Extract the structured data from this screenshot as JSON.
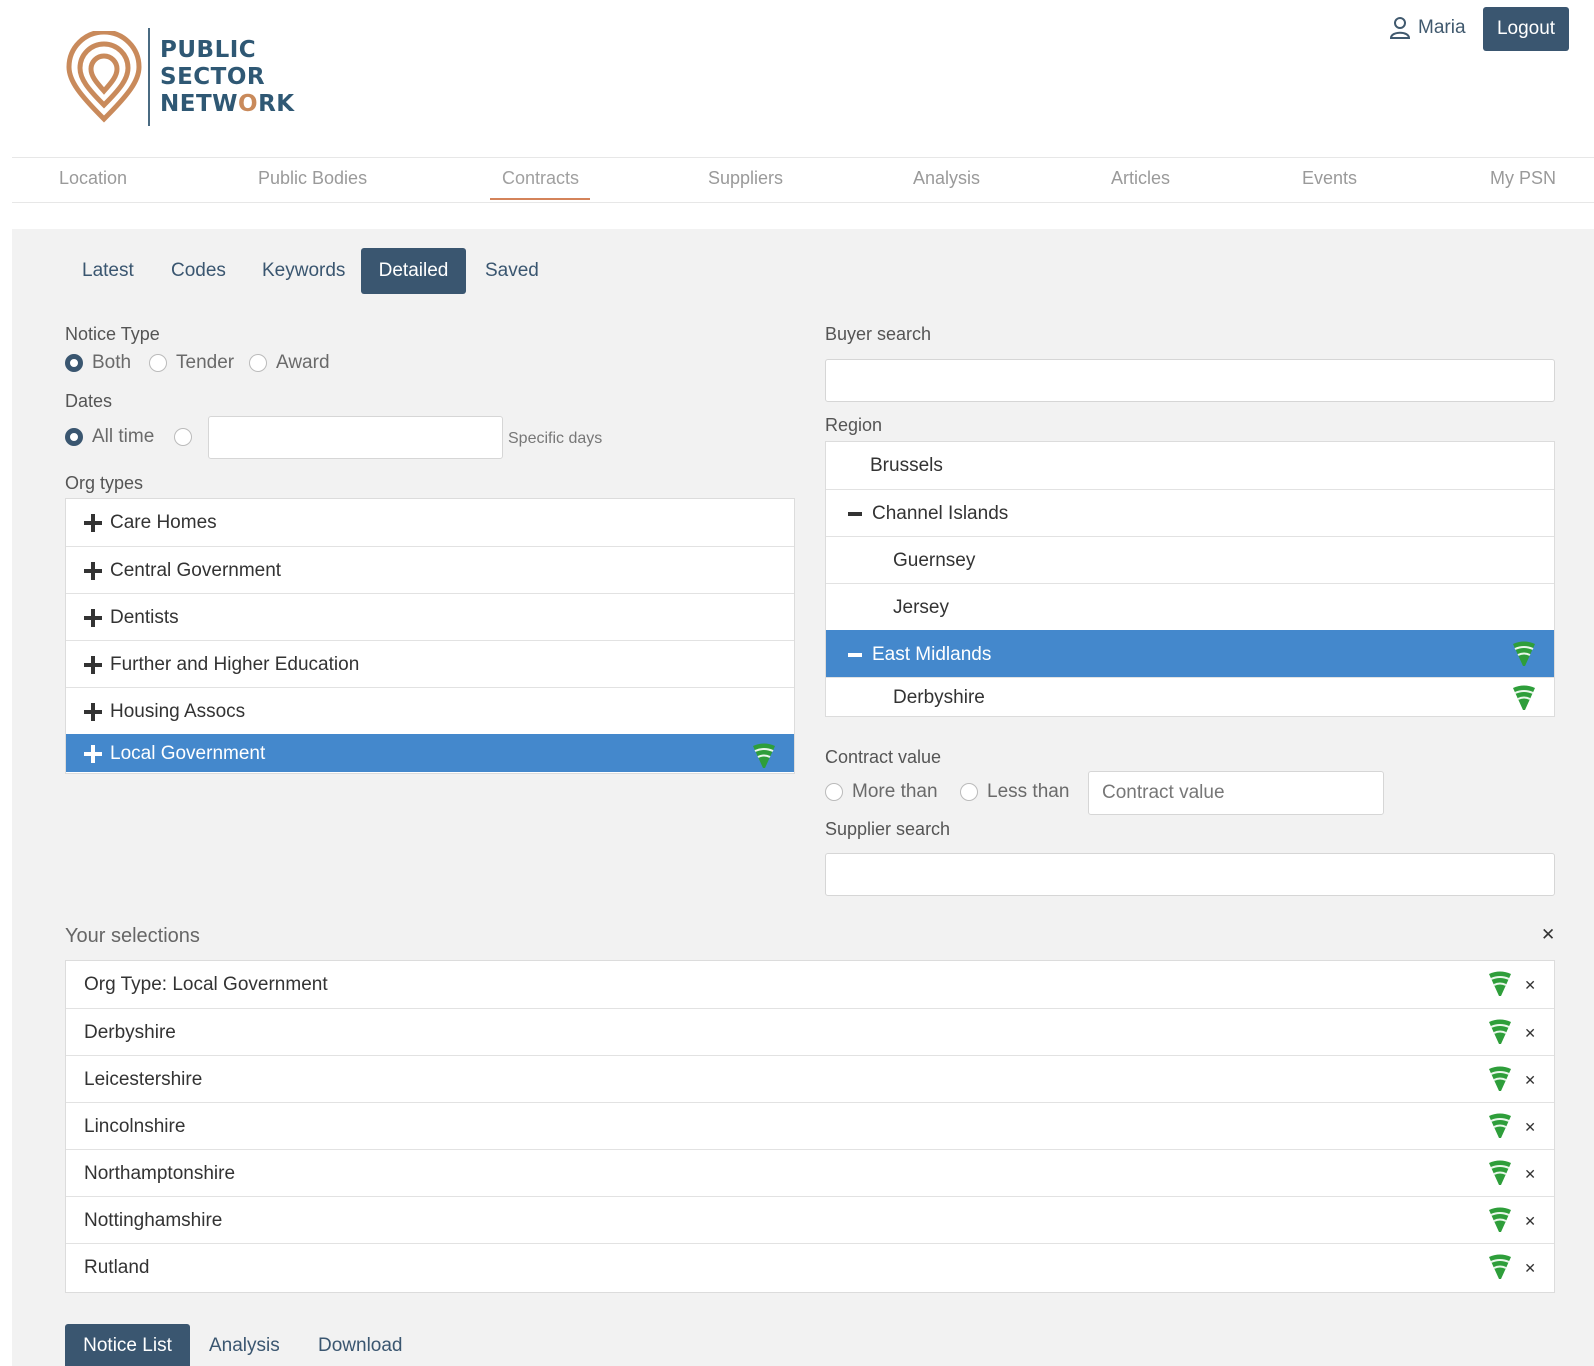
{
  "logo": {
    "line1": "PUBLIC",
    "line2": "SECTOR",
    "line3a": "NETW",
    "line3o": "O",
    "line3b": "RK"
  },
  "user": {
    "name": "Maria",
    "logout_label": "Logout"
  },
  "main_nav": [
    "Location",
    "Public Bodies",
    "Contracts",
    "Suppliers",
    "Analysis",
    "Articles",
    "Events",
    "My PSN"
  ],
  "main_nav_active": "Contracts",
  "sub_tabs": [
    "Latest",
    "Codes",
    "Keywords",
    "Detailed",
    "Saved"
  ],
  "sub_tab_active": "Detailed",
  "notice_type": {
    "label": "Notice Type",
    "options": [
      "Both",
      "Tender",
      "Award"
    ],
    "selected": "Both"
  },
  "dates": {
    "label": "Dates",
    "all_time": "All time",
    "specific_days": "Specific days",
    "value": ""
  },
  "org_types": {
    "label": "Org types",
    "items": [
      "Care Homes",
      "Central Government",
      "Dentists",
      "Further and Higher Education",
      "Housing Assocs",
      "Local Government"
    ],
    "selected": "Local Government"
  },
  "buyer_search": {
    "label": "Buyer search",
    "value": ""
  },
  "region": {
    "label": "Region",
    "items": [
      {
        "label": "Brussels",
        "indent": 0,
        "sign": ""
      },
      {
        "label": "Channel Islands",
        "indent": 0,
        "sign": "minus"
      },
      {
        "label": "Guernsey",
        "indent": 1,
        "sign": ""
      },
      {
        "label": "Jersey",
        "indent": 1,
        "sign": ""
      },
      {
        "label": "East Midlands",
        "indent": 0,
        "sign": "minus",
        "selected": true,
        "icon": "cone-icon"
      },
      {
        "label": "Derbyshire",
        "indent": 1,
        "sign": "",
        "icon": "cone-icon"
      }
    ]
  },
  "contract_value": {
    "label": "Contract value",
    "more_than": "More than",
    "less_than": "Less than",
    "placeholder": "Contract value"
  },
  "supplier_search": {
    "label": "Supplier search",
    "value": ""
  },
  "selections": {
    "label": "Your selections",
    "items": [
      "Org Type: Local Government",
      "Derbyshire",
      "Leicestershire",
      "Lincolnshire",
      "Northamptonshire",
      "Nottinghamshire",
      "Rutland"
    ]
  },
  "bottom_tabs": [
    "Notice List",
    "Analysis",
    "Download"
  ],
  "bottom_tab_active": "Notice List",
  "colors": {
    "navy": "#3a5670",
    "accent": "#d4835a",
    "selected": "#4488cc",
    "cone_green": "#2e9e3a"
  }
}
